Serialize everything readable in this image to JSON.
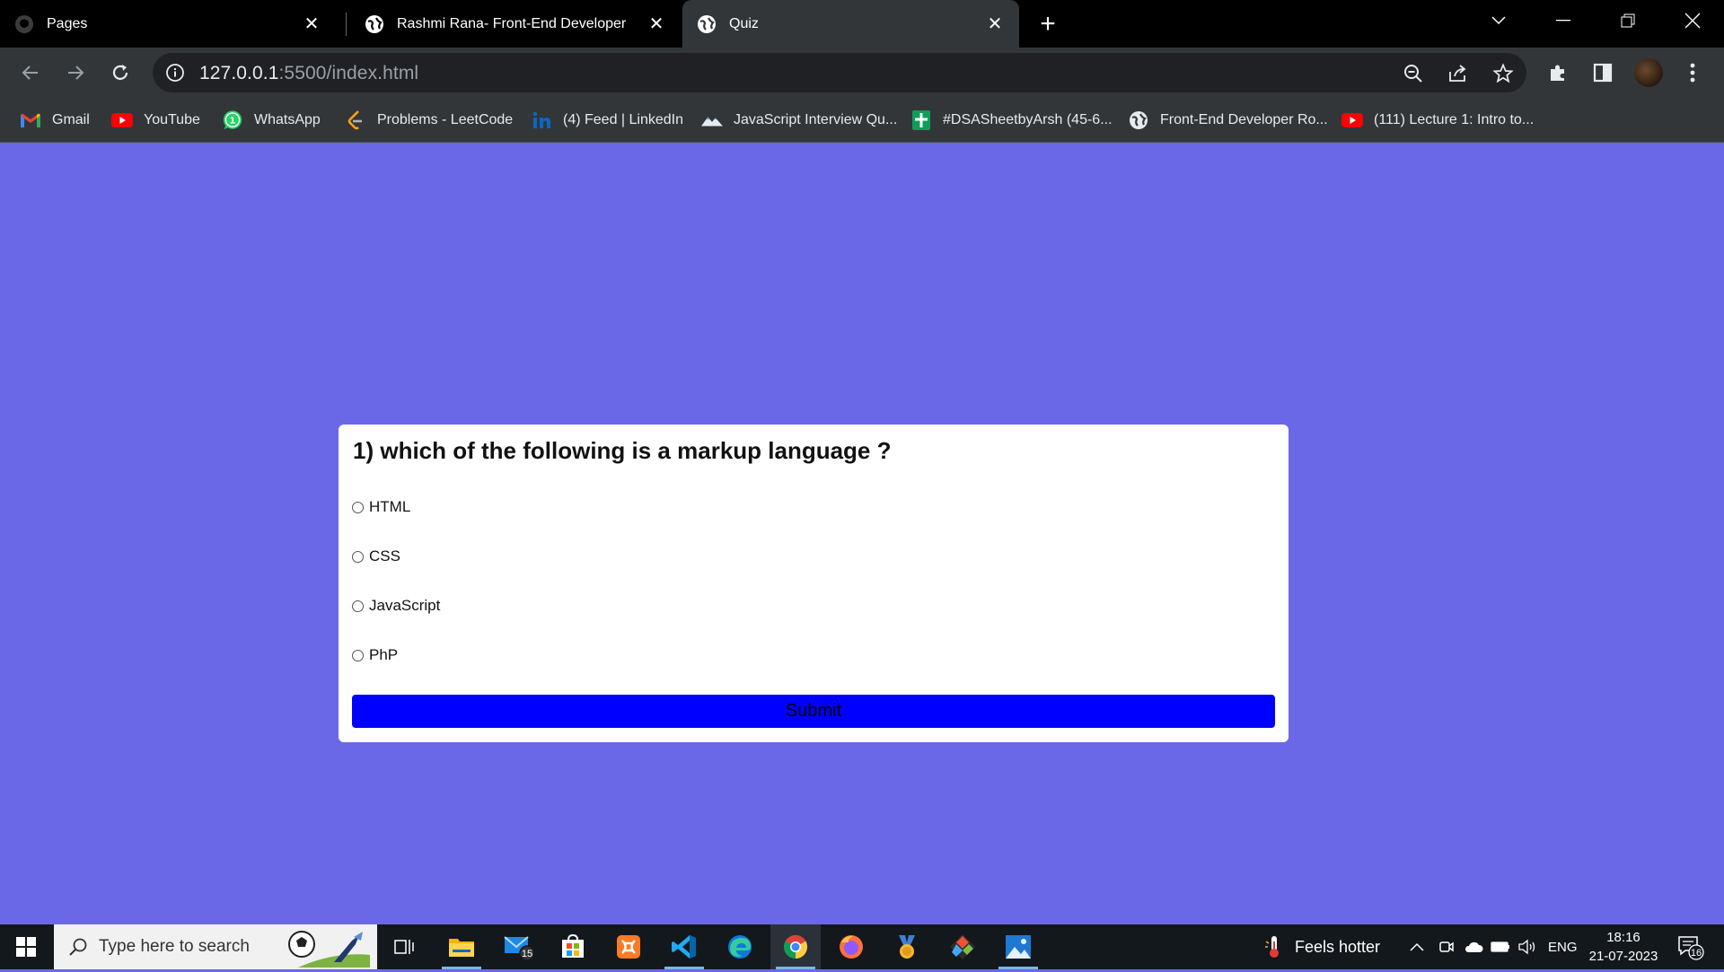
{
  "browser": {
    "tabs": [
      {
        "title": "Pages",
        "icon": "github-icon",
        "active": false
      },
      {
        "title": "Rashmi Rana- Front-End Developer",
        "icon": "globe-icon",
        "active": false
      },
      {
        "title": "Quiz",
        "icon": "globe-icon",
        "active": true
      }
    ],
    "address": {
      "host": "127.0.0.1",
      "path": ":5500/index.html"
    },
    "bookmarks": [
      {
        "label": "Gmail",
        "icon": "gmail-icon"
      },
      {
        "label": "YouTube",
        "icon": "youtube-icon"
      },
      {
        "label": "WhatsApp",
        "icon": "whatsapp-icon"
      },
      {
        "label": "Problems - LeetCode",
        "icon": "leetcode-icon"
      },
      {
        "label": "(4) Feed | LinkedIn",
        "icon": "linkedin-icon"
      },
      {
        "label": "JavaScript Interview Qu...",
        "icon": "mountain-icon"
      },
      {
        "label": "#DSASheetbyArsh (45-6...",
        "icon": "sheets-icon"
      },
      {
        "label": "Front-End Developer Ro...",
        "icon": "globe-icon"
      },
      {
        "label": "(111) Lecture 1: Intro to...",
        "icon": "youtube-icon"
      }
    ],
    "whatsapp_badge": "1"
  },
  "quiz": {
    "question": "1) which of the following is a markup language ?",
    "options": [
      "HTML",
      "CSS",
      "JavaScript",
      "PhP"
    ],
    "submit_label": "Submit"
  },
  "taskbar": {
    "search_placeholder": "Type here to search",
    "mail_badge": "15",
    "weather_text": "Feels hotter",
    "language": "ENG",
    "time": "18:16",
    "date": "21-07-2023",
    "notification_count": "16"
  },
  "colors": {
    "page_background": "#6b68e8",
    "submit_button": "#0000ff"
  }
}
